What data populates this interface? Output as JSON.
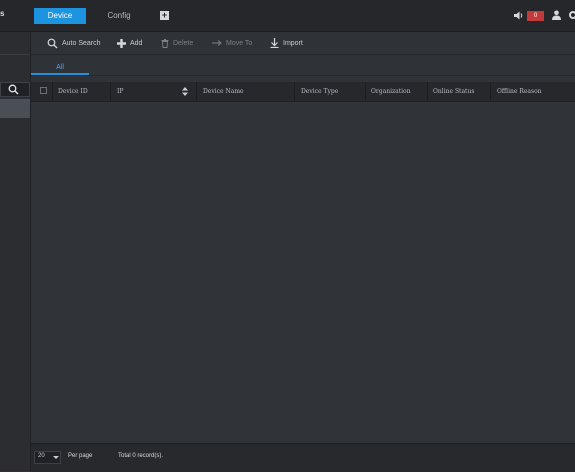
{
  "topbar": {
    "left_text": "s",
    "tabs": [
      {
        "label": "Device"
      },
      {
        "label": "Config"
      }
    ],
    "add_tab_glyph": "+",
    "alarm_count": "0",
    "icons": [
      "speaker-icon",
      "user-icon",
      "gear-icon"
    ],
    "accent_color": "#1c94e0",
    "alarm_color": "#c43a3a"
  },
  "sidebar": {
    "search_icon": "search-icon"
  },
  "toolbar": {
    "items": [
      {
        "label": "Auto Search",
        "icon": "search-icon"
      },
      {
        "label": "Add",
        "icon": "plus-icon"
      },
      {
        "label": "Delete",
        "icon": "trash-icon"
      },
      {
        "label": "Move To",
        "icon": "move-icon"
      },
      {
        "label": "Import",
        "icon": "import-icon"
      }
    ]
  },
  "subtabs": [
    {
      "label": "All"
    }
  ],
  "table": {
    "columns": [
      {
        "label": "Device ID"
      },
      {
        "label": "IP"
      },
      {
        "label": "Device Name"
      },
      {
        "label": "Device Type"
      },
      {
        "label": "Organization"
      },
      {
        "label": "Online Status"
      },
      {
        "label": "Offline Reason"
      }
    ],
    "rows": []
  },
  "footer": {
    "per_page_value": "20",
    "per_page_label": "Per page",
    "total_label": "Total 0 record(s)."
  }
}
